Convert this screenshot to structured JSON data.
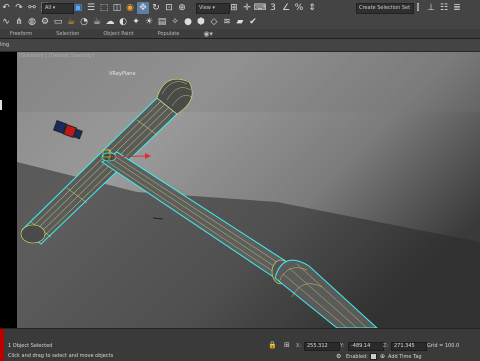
{
  "toolbar": {
    "filter_value": "All",
    "view_value": "View",
    "selection_set_placeholder": "Create Selection Set",
    "percent_icon_text": "%",
    "number_three": "3"
  },
  "ribbon": {
    "tabs": [
      "Freeform",
      "Selection",
      "Object Paint",
      "Populate"
    ]
  },
  "subbar": {
    "label": "ling"
  },
  "viewport": {
    "label": "[Standard ] [Default Shading ]",
    "object_label": "VRayPlane"
  },
  "status": {
    "selection": "1 Object Selected",
    "hint": "Click and drag to select and move objects",
    "x_label": "X:",
    "x_value": "255.312",
    "y_label": "Y:",
    "y_value": "-489.14",
    "z_label": "Z:",
    "z_value": "271.345",
    "grid_label": "Grid = 100.0",
    "enabled_label": "Enabled:",
    "add_time_tag": "Add Time Tag"
  },
  "colors": {
    "selection_outline": "#3ff0f0",
    "wire": "#d4e66a",
    "toolbar_bg": "#444444"
  }
}
